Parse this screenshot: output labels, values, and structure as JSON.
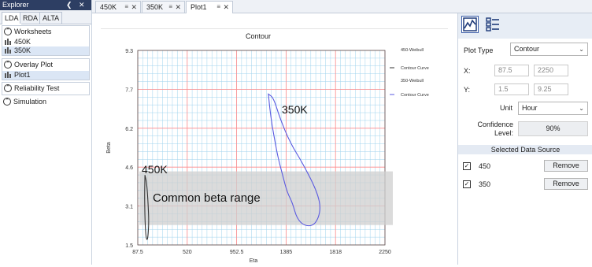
{
  "explorer": {
    "title": "Explorer",
    "tabs": [
      "LDA",
      "RDA",
      "ALTA"
    ],
    "groups": {
      "worksheets": {
        "label": "Worksheets",
        "items": [
          "450K",
          "350K"
        ]
      },
      "overlay": {
        "label": "Overlay Plot",
        "items": [
          "Plot1"
        ]
      },
      "reliability": {
        "label": "Reliability Test"
      },
      "simulation": {
        "label": "Simulation"
      }
    }
  },
  "doc_tabs": [
    {
      "label": "450K"
    },
    {
      "label": "350K"
    },
    {
      "label": "Plot1"
    }
  ],
  "chart": {
    "title": "Contour",
    "xlabel": "Eta",
    "ylabel": "Beta",
    "x_ticks": [
      "87.5",
      "520",
      "952.5",
      "1385",
      "1818",
      "2250"
    ],
    "y_ticks": [
      "9.3",
      "7.7",
      "6.2",
      "4.6",
      "3.1",
      "1.5"
    ],
    "legend": [
      {
        "name": "450-Weibull",
        "line": "Contour Curve",
        "color": "#333333"
      },
      {
        "name": "350-Weibull",
        "line": "Contour Curve",
        "color": "#5a5ae0"
      }
    ],
    "annotations": {
      "a450": "450K",
      "a350": "350K",
      "band": "Common beta range"
    },
    "colors": {
      "major_grid": "#ff8a8a",
      "minor_grid": "#9fd3ee",
      "band": "#cfcfcf"
    }
  },
  "chart_data": {
    "type": "line",
    "title": "Contour",
    "xlabel": "Eta",
    "ylabel": "Beta",
    "xlim": [
      87.5,
      2250
    ],
    "ylim": [
      1.5,
      9.3
    ],
    "legend_position": "right",
    "grid": true,
    "series": [
      {
        "name": "450-Weibull",
        "x": [
          150,
          165,
          178,
          185,
          175,
          160,
          150,
          147,
          150
        ],
        "y": [
          4.3,
          4.0,
          3.2,
          2.4,
          1.7,
          1.75,
          2.5,
          3.5,
          4.3
        ]
      },
      {
        "name": "350-Weibull",
        "x": [
          1230,
          1275,
          1330,
          1420,
          1540,
          1660,
          1690,
          1640,
          1550,
          1480,
          1440,
          1395,
          1355,
          1315,
          1290,
          1262,
          1242,
          1230
        ],
        "y": [
          7.55,
          7.4,
          6.6,
          5.6,
          4.7,
          3.6,
          2.9,
          2.3,
          2.25,
          2.55,
          3.2,
          3.6,
          4.3,
          5.0,
          5.6,
          6.3,
          7.0,
          7.55
        ]
      }
    ],
    "band": {
      "label": "Common beta range",
      "y": [
        2.3,
        4.45
      ]
    }
  },
  "right": {
    "plot_type_label": "Plot Type",
    "plot_type": "Contour",
    "x_label": "X:",
    "x_min": "87.5",
    "x_max": "2250",
    "y_label": "Y:",
    "y_min": "1.5",
    "y_max": "9.25",
    "unit_label": "Unit",
    "unit": "Hour",
    "confidence_label": "Confidence Level:",
    "confidence": "90%",
    "section_title": "Selected Data Source",
    "sources": [
      {
        "label": "450",
        "checked": true,
        "button": "Remove"
      },
      {
        "label": "350",
        "checked": true,
        "button": "Remove"
      }
    ]
  }
}
